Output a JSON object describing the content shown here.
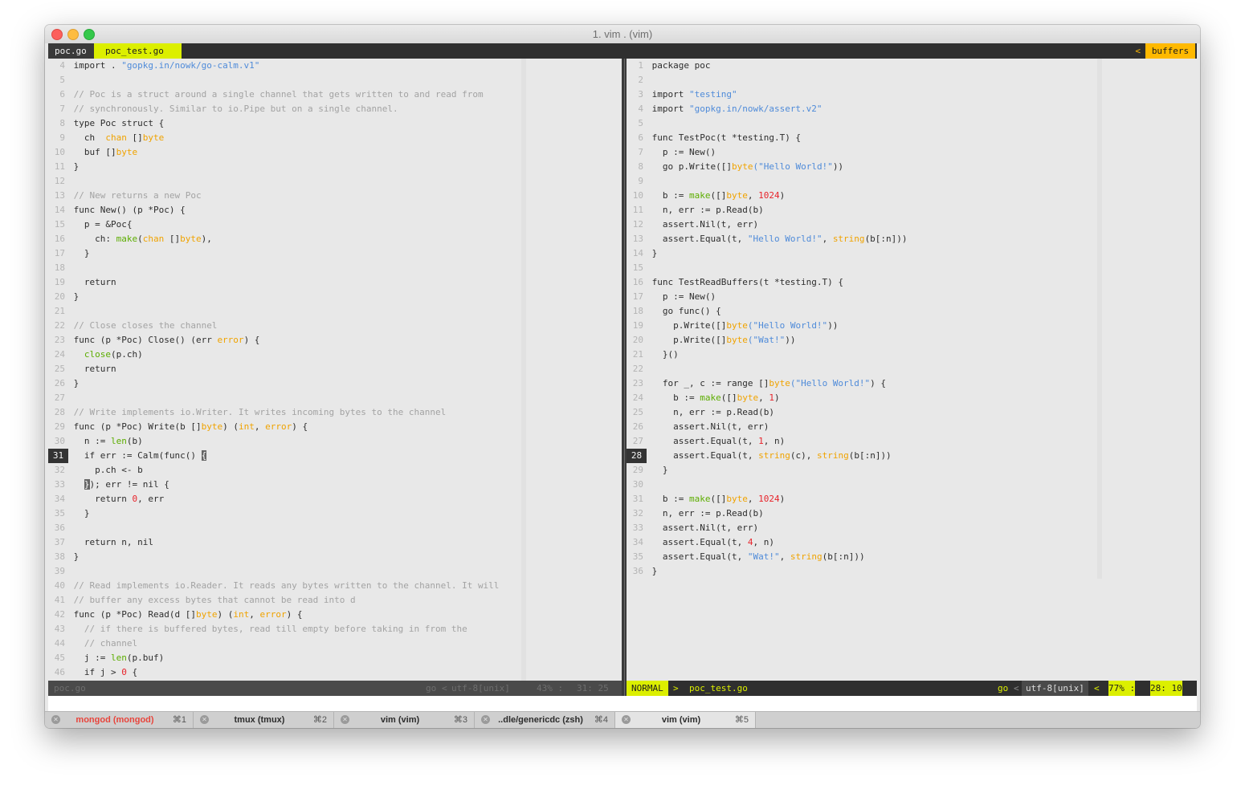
{
  "window": {
    "title": "1. vim . (vim)"
  },
  "tabline": {
    "tab1": "poc.go",
    "tab2": "poc_test.go",
    "arrow": "<",
    "buffers": "buffers"
  },
  "left_pane": {
    "current_line": 31,
    "lines": [
      {
        "n": 4,
        "t": [
          [
            "tx",
            "import . "
          ],
          [
            "str",
            "\"gopkg.in/nowk/go-calm.v1\""
          ]
        ]
      },
      {
        "n": 5,
        "t": []
      },
      {
        "n": 6,
        "t": [
          [
            "cmt",
            "// Poc is a struct around a single channel that gets written to and read from"
          ]
        ]
      },
      {
        "n": 7,
        "t": [
          [
            "cmt",
            "// synchronously. Similar to io.Pipe but on a single channel."
          ]
        ]
      },
      {
        "n": 8,
        "t": [
          [
            "tx",
            "type Poc struct {"
          ]
        ]
      },
      {
        "n": 9,
        "t": [
          [
            "tx",
            "  ch  "
          ],
          [
            "typ",
            "chan"
          ],
          [
            "tx",
            " []"
          ],
          [
            "typ",
            "byte"
          ]
        ]
      },
      {
        "n": 10,
        "t": [
          [
            "tx",
            "  buf []"
          ],
          [
            "typ",
            "byte"
          ]
        ]
      },
      {
        "n": 11,
        "t": [
          [
            "tx",
            "}"
          ]
        ]
      },
      {
        "n": 12,
        "t": []
      },
      {
        "n": 13,
        "t": [
          [
            "cmt",
            "// New returns a new Poc"
          ]
        ]
      },
      {
        "n": 14,
        "t": [
          [
            "tx",
            "func New() (p *Poc) {"
          ]
        ]
      },
      {
        "n": 15,
        "t": [
          [
            "tx",
            "  p = &Poc{"
          ]
        ]
      },
      {
        "n": 16,
        "t": [
          [
            "tx",
            "    ch: "
          ],
          [
            "fn",
            "make"
          ],
          [
            "tx",
            "("
          ],
          [
            "typ",
            "chan"
          ],
          [
            "tx",
            " []"
          ],
          [
            "typ",
            "byte"
          ],
          [
            "tx",
            "),"
          ]
        ]
      },
      {
        "n": 17,
        "t": [
          [
            "tx",
            "  }"
          ]
        ]
      },
      {
        "n": 18,
        "t": []
      },
      {
        "n": 19,
        "t": [
          [
            "tx",
            "  return"
          ]
        ]
      },
      {
        "n": 20,
        "t": [
          [
            "tx",
            "}"
          ]
        ]
      },
      {
        "n": 21,
        "t": []
      },
      {
        "n": 22,
        "t": [
          [
            "cmt",
            "// Close closes the channel"
          ]
        ]
      },
      {
        "n": 23,
        "t": [
          [
            "tx",
            "func (p *Poc) Close() (err "
          ],
          [
            "typ",
            "error"
          ],
          [
            "tx",
            ") {"
          ]
        ]
      },
      {
        "n": 24,
        "t": [
          [
            "tx",
            "  "
          ],
          [
            "fn",
            "close"
          ],
          [
            "tx",
            "(p.ch)"
          ]
        ]
      },
      {
        "n": 25,
        "t": [
          [
            "tx",
            "  return"
          ]
        ]
      },
      {
        "n": 26,
        "t": [
          [
            "tx",
            "}"
          ]
        ]
      },
      {
        "n": 27,
        "t": []
      },
      {
        "n": 28,
        "t": [
          [
            "cmt",
            "// Write implements io.Writer. It writes incoming bytes to the channel"
          ]
        ]
      },
      {
        "n": 29,
        "t": [
          [
            "tx",
            "func (p *Poc) Write(b []"
          ],
          [
            "typ",
            "byte"
          ],
          [
            "tx",
            ") ("
          ],
          [
            "typ",
            "int"
          ],
          [
            "tx",
            ", "
          ],
          [
            "typ",
            "error"
          ],
          [
            "tx",
            ") {"
          ]
        ]
      },
      {
        "n": 30,
        "t": [
          [
            "tx",
            "  n := "
          ],
          [
            "fn",
            "len"
          ],
          [
            "tx",
            "(b)"
          ]
        ]
      },
      {
        "n": 31,
        "t": [
          [
            "tx",
            "  if err := Calm(func() "
          ],
          [
            "curs",
            "{"
          ]
        ]
      },
      {
        "n": 32,
        "t": [
          [
            "tx",
            "    p.ch <- b"
          ]
        ]
      },
      {
        "n": 33,
        "t": [
          [
            "tx",
            "  "
          ],
          [
            "curs",
            "}"
          ],
          [
            "tx",
            "); err != nil {"
          ]
        ]
      },
      {
        "n": 34,
        "t": [
          [
            "tx",
            "    return "
          ],
          [
            "red",
            "0"
          ],
          [
            "tx",
            ", err"
          ]
        ]
      },
      {
        "n": 35,
        "t": [
          [
            "tx",
            "  }"
          ]
        ]
      },
      {
        "n": 36,
        "t": []
      },
      {
        "n": 37,
        "t": [
          [
            "tx",
            "  return n, nil"
          ]
        ]
      },
      {
        "n": 38,
        "t": [
          [
            "tx",
            "}"
          ]
        ]
      },
      {
        "n": 39,
        "t": []
      },
      {
        "n": 40,
        "t": [
          [
            "cmt",
            "// Read implements io.Reader. It reads any bytes written to the channel. It will"
          ]
        ]
      },
      {
        "n": 41,
        "t": [
          [
            "cmt",
            "// buffer any excess bytes that cannot be read into d"
          ]
        ]
      },
      {
        "n": 42,
        "t": [
          [
            "tx",
            "func (p *Poc) Read(d []"
          ],
          [
            "typ",
            "byte"
          ],
          [
            "tx",
            ") ("
          ],
          [
            "typ",
            "int"
          ],
          [
            "tx",
            ", "
          ],
          [
            "typ",
            "error"
          ],
          [
            "tx",
            ") {"
          ]
        ]
      },
      {
        "n": 43,
        "t": [
          [
            "cmt",
            "  // if there is buffered bytes, read till empty before taking in from the"
          ]
        ]
      },
      {
        "n": 44,
        "t": [
          [
            "cmt",
            "  // channel"
          ]
        ]
      },
      {
        "n": 45,
        "t": [
          [
            "tx",
            "  j := "
          ],
          [
            "fn",
            "len"
          ],
          [
            "tx",
            "(p.buf)"
          ]
        ]
      },
      {
        "n": 46,
        "t": [
          [
            "tx",
            "  if j > "
          ],
          [
            "red",
            "0"
          ],
          [
            "tx",
            " {"
          ]
        ]
      }
    ]
  },
  "right_pane": {
    "current_line": 28,
    "lines": [
      {
        "n": 1,
        "t": [
          [
            "tx",
            "package poc"
          ]
        ]
      },
      {
        "n": 2,
        "t": []
      },
      {
        "n": 3,
        "t": [
          [
            "tx",
            "import "
          ],
          [
            "str",
            "\"testing\""
          ]
        ]
      },
      {
        "n": 4,
        "t": [
          [
            "tx",
            "import "
          ],
          [
            "str",
            "\"gopkg.in/nowk/assert.v2\""
          ]
        ]
      },
      {
        "n": 5,
        "t": []
      },
      {
        "n": 6,
        "t": [
          [
            "tx",
            "func TestPoc(t *testing.T) {"
          ]
        ]
      },
      {
        "n": 7,
        "t": [
          [
            "tx",
            "  p := New()"
          ]
        ]
      },
      {
        "n": 8,
        "t": [
          [
            "tx",
            "  go p.Write([]"
          ],
          [
            "typ",
            "byte"
          ],
          [
            "str",
            "(\"Hello World!\""
          ],
          [
            "tx",
            "))"
          ]
        ]
      },
      {
        "n": 9,
        "t": []
      },
      {
        "n": 10,
        "t": [
          [
            "tx",
            "  b := "
          ],
          [
            "fn",
            "make"
          ],
          [
            "tx",
            "([]"
          ],
          [
            "typ",
            "byte"
          ],
          [
            "tx",
            ", "
          ],
          [
            "red",
            "1024"
          ],
          [
            "tx",
            ")"
          ]
        ]
      },
      {
        "n": 11,
        "t": [
          [
            "tx",
            "  n, err := p.Read(b)"
          ]
        ]
      },
      {
        "n": 12,
        "t": [
          [
            "tx",
            "  assert.Nil(t, err)"
          ]
        ]
      },
      {
        "n": 13,
        "t": [
          [
            "tx",
            "  assert.Equal(t, "
          ],
          [
            "str",
            "\"Hello World!\""
          ],
          [
            "tx",
            ", "
          ],
          [
            "typ",
            "string"
          ],
          [
            "tx",
            "(b[:n]))"
          ]
        ]
      },
      {
        "n": 14,
        "t": [
          [
            "tx",
            "}"
          ]
        ]
      },
      {
        "n": 15,
        "t": []
      },
      {
        "n": 16,
        "t": [
          [
            "tx",
            "func TestReadBuffers(t *testing.T) {"
          ]
        ]
      },
      {
        "n": 17,
        "t": [
          [
            "tx",
            "  p := New()"
          ]
        ]
      },
      {
        "n": 18,
        "t": [
          [
            "tx",
            "  go func() {"
          ]
        ]
      },
      {
        "n": 19,
        "t": [
          [
            "tx",
            "    p.Write([]"
          ],
          [
            "typ",
            "byte"
          ],
          [
            "str",
            "(\"Hello World!\""
          ],
          [
            "tx",
            "))"
          ]
        ]
      },
      {
        "n": 20,
        "t": [
          [
            "tx",
            "    p.Write([]"
          ],
          [
            "typ",
            "byte"
          ],
          [
            "str",
            "(\"Wat!\""
          ],
          [
            "tx",
            "))"
          ]
        ]
      },
      {
        "n": 21,
        "t": [
          [
            "tx",
            "  }()"
          ]
        ]
      },
      {
        "n": 22,
        "t": []
      },
      {
        "n": 23,
        "t": [
          [
            "tx",
            "  for _, c := range []"
          ],
          [
            "typ",
            "byte"
          ],
          [
            "str",
            "(\"Hello World!\""
          ],
          [
            "tx",
            ") {"
          ]
        ]
      },
      {
        "n": 24,
        "t": [
          [
            "tx",
            "    b := "
          ],
          [
            "fn",
            "make"
          ],
          [
            "tx",
            "([]"
          ],
          [
            "typ",
            "byte"
          ],
          [
            "tx",
            ", "
          ],
          [
            "red",
            "1"
          ],
          [
            "tx",
            ")"
          ]
        ]
      },
      {
        "n": 25,
        "t": [
          [
            "tx",
            "    n, err := p.Read(b)"
          ]
        ]
      },
      {
        "n": 26,
        "t": [
          [
            "tx",
            "    assert.Nil(t, err)"
          ]
        ]
      },
      {
        "n": 27,
        "t": [
          [
            "tx",
            "    assert.Equal(t, "
          ],
          [
            "red",
            "1"
          ],
          [
            "tx",
            ", n)"
          ]
        ]
      },
      {
        "n": 28,
        "t": [
          [
            "tx",
            "    assert.Equal(t, "
          ],
          [
            "typ",
            "string"
          ],
          [
            "tx",
            "(c), "
          ],
          [
            "typ",
            "string"
          ],
          [
            "tx",
            "(b[:n]))"
          ]
        ]
      },
      {
        "n": 29,
        "t": [
          [
            "tx",
            "  }"
          ]
        ]
      },
      {
        "n": 30,
        "t": []
      },
      {
        "n": 31,
        "t": [
          [
            "tx",
            "  b := "
          ],
          [
            "fn",
            "make"
          ],
          [
            "tx",
            "([]"
          ],
          [
            "typ",
            "byte"
          ],
          [
            "tx",
            ", "
          ],
          [
            "red",
            "1024"
          ],
          [
            "tx",
            ")"
          ]
        ]
      },
      {
        "n": 32,
        "t": [
          [
            "tx",
            "  n, err := p.Read(b)"
          ]
        ]
      },
      {
        "n": 33,
        "t": [
          [
            "tx",
            "  assert.Nil(t, err)"
          ]
        ]
      },
      {
        "n": 34,
        "t": [
          [
            "tx",
            "  assert.Equal(t, "
          ],
          [
            "red",
            "4"
          ],
          [
            "tx",
            ", n)"
          ]
        ]
      },
      {
        "n": 35,
        "t": [
          [
            "tx",
            "  assert.Equal(t, "
          ],
          [
            "str",
            "\"Wat!\""
          ],
          [
            "tx",
            ", "
          ],
          [
            "typ",
            "string"
          ],
          [
            "tx",
            "(b[:n]))"
          ]
        ]
      },
      {
        "n": 36,
        "t": [
          [
            "tx",
            "}"
          ]
        ]
      }
    ]
  },
  "left_status": {
    "filename": "poc.go",
    "filetype": "go",
    "sep": "<",
    "encoding": "utf-8[unix]",
    "percent": "43% :",
    "position": "31: 25"
  },
  "right_status": {
    "mode": "NORMAL",
    "arrow": ">",
    "filename": "poc_test.go",
    "filetype": "go",
    "sep": "<",
    "encoding": "utf-8[unix]",
    "sep2": "<",
    "percent": "77% :",
    "position": "28: 10"
  },
  "colors": {
    "accent_green": "#dcef00",
    "accent_orange": "#ffb900",
    "string": "#4f8bd9",
    "type": "#f0a300",
    "builtin": "#5cad00",
    "number": "#e8242b"
  },
  "tmux_tabs": [
    {
      "name": "mongod (mongod)",
      "shortcut": "⌘1",
      "icon": "close-icon",
      "alert": true
    },
    {
      "name": "tmux (tmux)",
      "shortcut": "⌘2",
      "icon": "close-icon"
    },
    {
      "name": "vim (vim)",
      "shortcut": "⌘3",
      "icon": "close-icon"
    },
    {
      "name": "..dle/genericdc (zsh)",
      "shortcut": "⌘4",
      "icon": "close-icon"
    },
    {
      "name": "vim (vim)",
      "shortcut": "⌘5",
      "icon": "close-icon",
      "active": true
    }
  ]
}
